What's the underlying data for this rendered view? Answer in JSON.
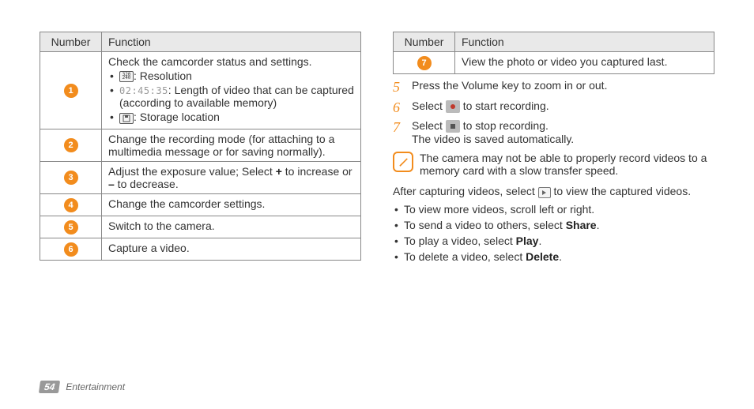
{
  "tableHeaders": {
    "number": "Number",
    "function": "Function"
  },
  "left": {
    "rows": [
      {
        "num": "1",
        "lead": "Check the camcorder status and settings.",
        "bullets": [
          {
            "iconText": "320 240",
            "text": ": Resolution"
          },
          {
            "timer": "02:45:35",
            "text": ": Length of video that can be captured (according to available memory)"
          },
          {
            "iconStorage": true,
            "text": ": Storage location"
          }
        ]
      },
      {
        "num": "2",
        "text": "Change the recording mode (for attaching to a multimedia message or for saving normally)."
      },
      {
        "num": "3",
        "text_pre": "Adjust the exposure value; Select ",
        "plus": "+",
        "mid": " to increase or ",
        "minus": "–",
        "post": " to decrease."
      },
      {
        "num": "4",
        "text": "Change the camcorder settings."
      },
      {
        "num": "5",
        "text": "Switch to the camera."
      },
      {
        "num": "6",
        "text": "Capture a video."
      }
    ]
  },
  "right": {
    "rows": [
      {
        "num": "7",
        "text": "View the photo or video you captured last."
      }
    ],
    "steps": [
      {
        "n": "5",
        "text": "Press the Volume key to zoom in or out."
      },
      {
        "n": "6",
        "pre": "Select ",
        "icon": "record",
        "post": " to start recording."
      },
      {
        "n": "7",
        "pre": "Select ",
        "icon": "stop",
        "post": " to stop recording.",
        "extra": "The video is saved automatically."
      }
    ],
    "note": "The camera may not be able to properly record videos to a memory card with a slow transfer speed.",
    "after_pre": "After capturing videos, select ",
    "after_post": " to view the captured videos.",
    "actions": [
      {
        "text": "To view more videos, scroll left or right."
      },
      {
        "pre": "To send a video to others, select ",
        "bold": "Share",
        "post": "."
      },
      {
        "pre": "To play a video, select ",
        "bold": "Play",
        "post": "."
      },
      {
        "pre": "To delete a video, select ",
        "bold": "Delete",
        "post": "."
      }
    ]
  },
  "footer": {
    "page": "54",
    "section": "Entertainment"
  }
}
